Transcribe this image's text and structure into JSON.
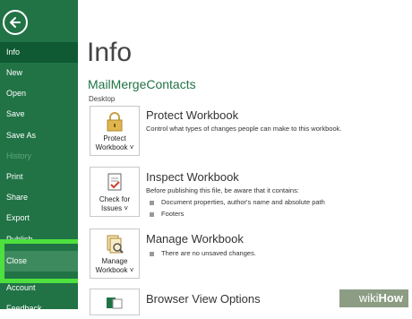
{
  "sidebar": {
    "back_label": "",
    "items": [
      {
        "label": "Info"
      },
      {
        "label": "New"
      },
      {
        "label": "Open"
      },
      {
        "label": "Save"
      },
      {
        "label": "Save As"
      },
      {
        "label": "History"
      },
      {
        "label": "Print"
      },
      {
        "label": "Share"
      },
      {
        "label": "Export"
      },
      {
        "label": "Publish"
      },
      {
        "label": "Close"
      },
      {
        "label": "Account"
      },
      {
        "label": "Feedback"
      }
    ]
  },
  "main": {
    "title": "Info",
    "file_name": "MailMergeContacts",
    "file_location": "Desktop",
    "sections": [
      {
        "button_line1": "Protect",
        "button_line2": "Workbook ˅",
        "title": "Protect Workbook",
        "description": "Control what types of changes people can make to this workbook."
      },
      {
        "button_line1": "Check for",
        "button_line2": "Issues ˅",
        "title": "Inspect Workbook",
        "description": "Before publishing this file, be aware that it contains:",
        "bullets": [
          "Document properties, author's name and absolute path",
          "Footers"
        ]
      },
      {
        "button_line1": "Manage",
        "button_line2": "Workbook ˅",
        "title": "Manage Workbook",
        "description": "There are no unsaved changes."
      },
      {
        "title": "Browser View Options"
      }
    ]
  },
  "watermark": {
    "wiki": "wiki",
    "how": "How"
  },
  "colors": {
    "sidebar": "#217346",
    "highlight": "#4ee03e"
  }
}
